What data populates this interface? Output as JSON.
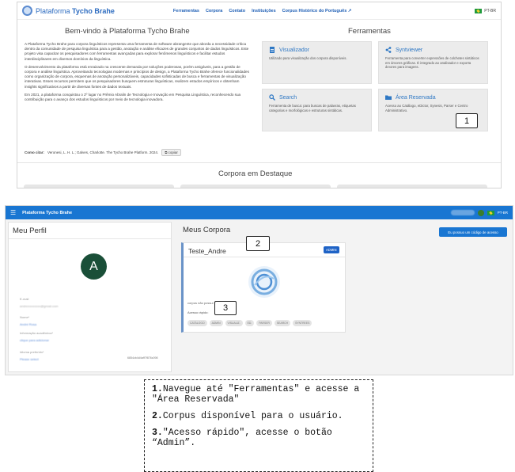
{
  "top": {
    "brand_prefix": "Plataforma",
    "brand_name": "Tycho Brahe",
    "nav": [
      "Ferramentas",
      "Corpora",
      "Contato",
      "Instituições",
      "Corpus Histórico do Português ↗"
    ],
    "lang": "PT-BR",
    "welcome_title": "Bem-vindo à Plataforma Tycho Brahe",
    "tools_title": "Ferramentas",
    "intro": [
      "A Plataforma Tycho Brahe para corpora linguísticos representa uma ferramenta de software abrangente que aborda a necessidade crítica dentro da comunidade de pesquisa linguística para a gestão, anotação e análise eficazes de grandes conjuntos de dados linguísticos. Este projeto visa capacitar os pesquisadores com ferramentas avançadas para explorar fenômenos linguísticos e facilitar estudos interdisciplinares em diversos domínios da linguística.",
      "O desenvolvimento da plataforma está enraizado na crescente demanda por soluções poderosas, porém amigáveis, para a gestão de corpora e análise linguística. Aproveitando tecnologias modernas e princípios de design, a Plataforma Tycho Brahe oferece funcionalidades como organização de corpora, esquemas de anotação personalizáveis, capacidades sofisticadas de busca e ferramentas de visualização interativas. Esses recursos permitem que os pesquisadores busquem estruturas linguísticas, realizem estudos empíricos e obtenham insights significativos a partir de diversas fontes de dados textuais.",
      "Em 2021, a plataforma conquistou o 2º lugar no Prêmio Abralin de Tecnologia e Inovação em Pesquisa Linguística, reconhecendo sua contribuição para o avanço dos estudos linguísticos por meio de tecnologia inovadora."
    ],
    "cite_label": "Como citar:",
    "cite_text": "Veronesi, L. H. L.; Galves, Charlotte. The Tycho Brahe Platform. 2024.",
    "copy_label": "copiar",
    "tools": [
      {
        "title": "Visualizador",
        "desc": "Utilizado para visualização dos corpora disponíveis."
      },
      {
        "title": "Syntviewer",
        "desc": "Ferramenta para converter expressões de colchetes sintáticos em árvores gráficas. É integrado ao analisador e exporta árvores para imagens."
      },
      {
        "title": "Search",
        "desc": "Ferramenta de busca: para buscas de palavras, etiquetas categorias e morfológicas e estruturas sintáticas."
      },
      {
        "title": "Área Reservada",
        "desc": "Acesso ao Catálogo, eDictor, Synesis, Parser e Centro Administrativo."
      }
    ],
    "corpora_title": "Corpora em Destaque"
  },
  "mid": {
    "app_title": "Plataforma Tycho Brahe",
    "lang": "PT-BR",
    "profile_title": "Meu Perfil",
    "avatar_letter": "A",
    "corpora_title": "Meus Corpora",
    "access_button": "Eu possuo um código de acesso",
    "corpus": {
      "name": "Teste_Andre",
      "badge": "ADMIN",
      "desc": "corpus não possui",
      "quick_label": "Acesso rápido:",
      "chips": [
        "CATÁLOGO",
        "ADMIN",
        "VISUALIZ.",
        "ED.",
        "PARSER",
        "SEARCH",
        "SYNTREES"
      ]
    }
  },
  "callouts": [
    "1",
    "2",
    "3"
  ],
  "steps": [
    {
      "num": "1.",
      "text": "Navegue até \"Ferramentas\" e acesse a \"Área Reservada\""
    },
    {
      "num": "2.",
      "text": "Corpus disponível para o usuário."
    },
    {
      "num": "3.",
      "text": "\"Acesso rápido\", acesse o botão “Admin”."
    }
  ]
}
